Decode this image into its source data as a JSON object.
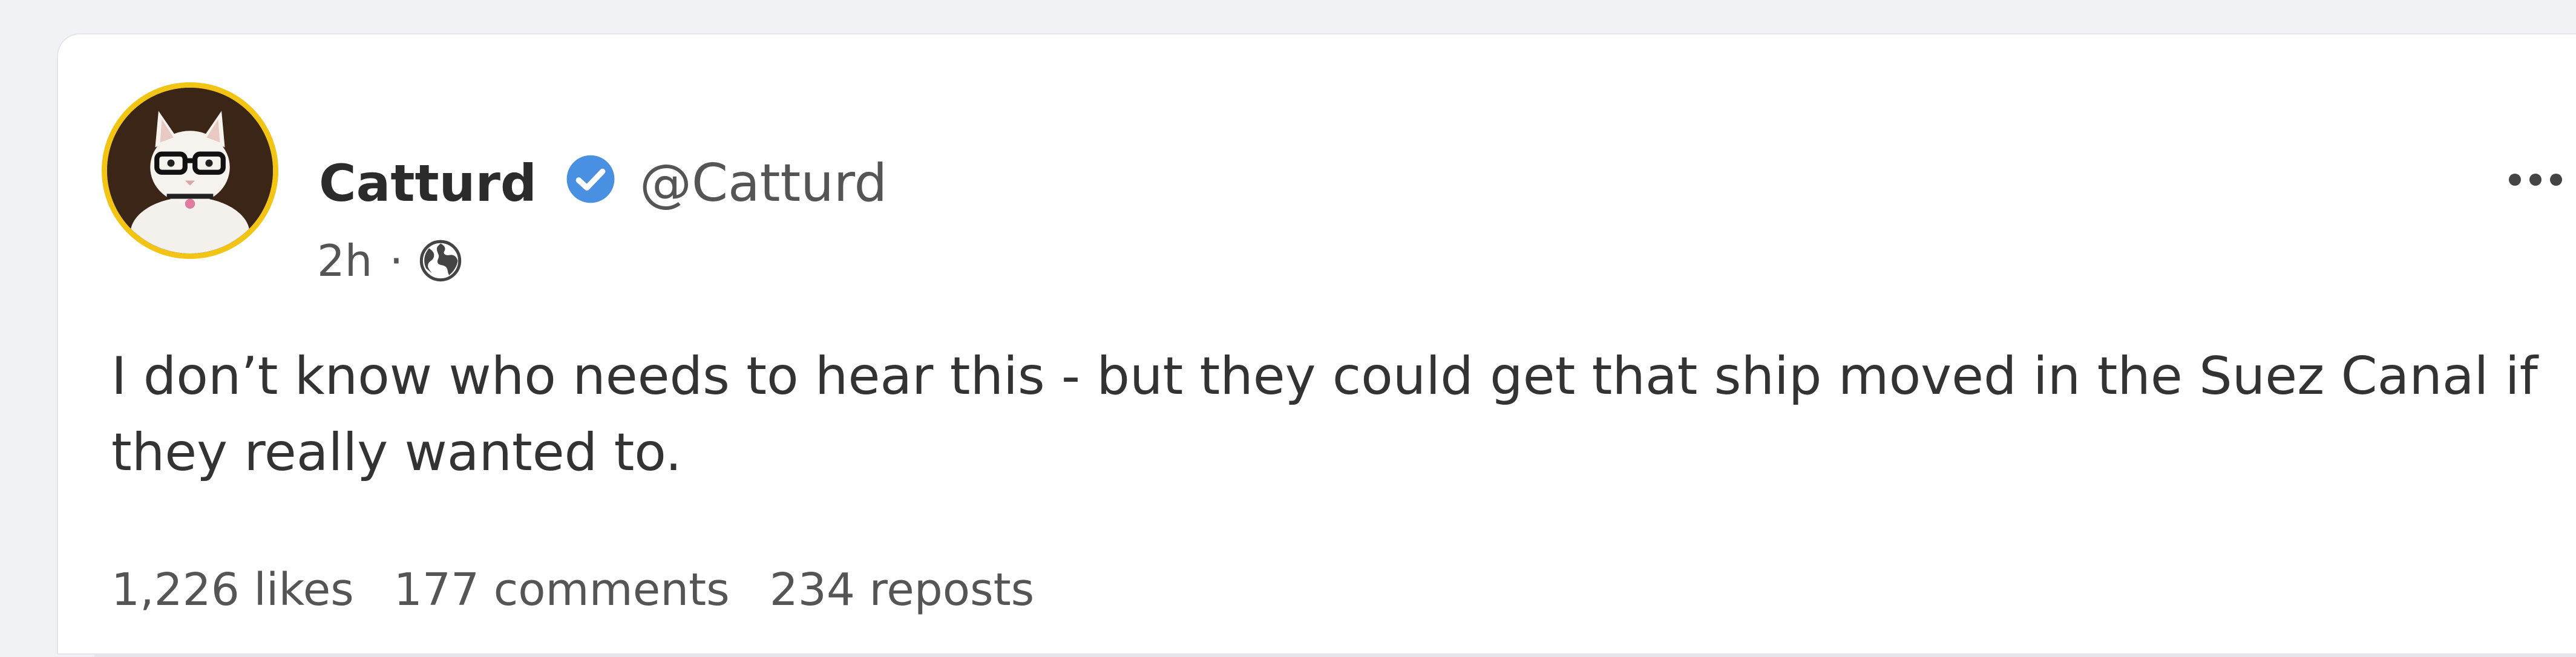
{
  "post": {
    "author": {
      "display_name": "Catturd",
      "handle": "@Catturd",
      "verified": true,
      "avatar_icon": "cat-with-glasses-avatar"
    },
    "time_ago": "2h",
    "separator": "·",
    "visibility_icon": "globe-icon",
    "text": "I don’t know who needs to hear this - but they could get that ship moved in the Suez Canal if they really wanted to.",
    "stats": {
      "likes": "1,226 likes",
      "comments": "177 comments",
      "reposts": "234 reposts"
    }
  },
  "colors": {
    "page_background": "#f0f2f5",
    "card_background": "#ffffff",
    "verified_badge": "#4a90e2",
    "avatar_ring": "#f2c413"
  }
}
